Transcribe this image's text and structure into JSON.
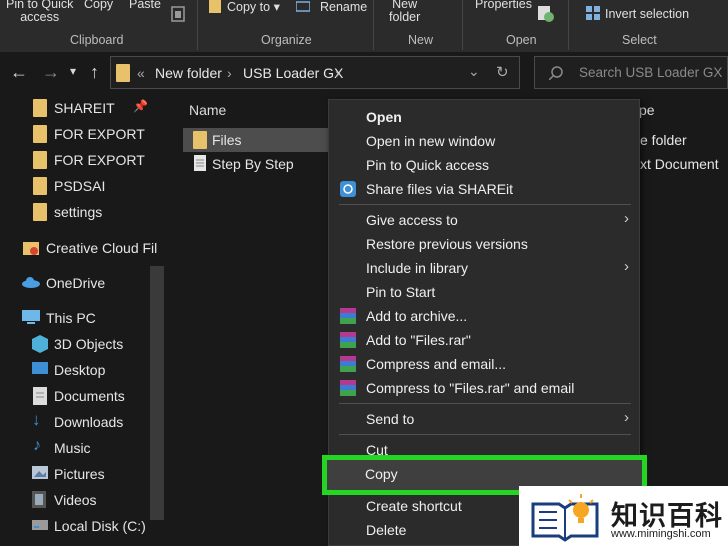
{
  "ribbon": {
    "pin_to_quick_access": "Pin to Quick\naccess",
    "copy": "Copy",
    "paste": "Paste",
    "copy_to": "Copy to",
    "rename": "Rename",
    "new_folder": "New\nfolder",
    "properties": "Properties",
    "invert_selection": "Invert selection",
    "groups": {
      "clipboard": "Clipboard",
      "organize": "Organize",
      "new": "New",
      "open": "Open",
      "select": "Select"
    }
  },
  "address": {
    "prefix": "«",
    "crumb1": "New folder",
    "sep": "›",
    "crumb2": "USB Loader GX",
    "search_placeholder": "Search USB Loader GX"
  },
  "navpane": {
    "items": [
      {
        "label": "SHAREIT",
        "icon": "folder-icon"
      },
      {
        "label": "FOR EXPORT",
        "icon": "folder-icon"
      },
      {
        "label": "FOR EXPORT",
        "icon": "folder-icon"
      },
      {
        "label": "PSDSAI",
        "icon": "folder-icon"
      },
      {
        "label": "settings",
        "icon": "folder-icon"
      },
      {
        "label": "Creative Cloud Fil",
        "icon": "creative-cloud-icon"
      },
      {
        "label": "OneDrive",
        "icon": "cloud-icon"
      },
      {
        "label": "This PC",
        "icon": "computer-icon"
      },
      {
        "label": "3D Objects",
        "icon": "cube-icon"
      },
      {
        "label": "Desktop",
        "icon": "desktop-icon"
      },
      {
        "label": "Documents",
        "icon": "documents-icon"
      },
      {
        "label": "Downloads",
        "icon": "download-icon"
      },
      {
        "label": "Music",
        "icon": "music-icon"
      },
      {
        "label": "Pictures",
        "icon": "pictures-icon"
      },
      {
        "label": "Videos",
        "icon": "video-icon"
      },
      {
        "label": "Local Disk (C:)",
        "icon": "disk-icon"
      }
    ]
  },
  "filepane": {
    "col_name": "Name",
    "col_type_partial": "pe",
    "files": [
      {
        "name": "Files",
        "type_partial": "e folder"
      },
      {
        "name": "Step By Step",
        "type_partial": "xt Document"
      }
    ]
  },
  "context_menu": {
    "items": {
      "open": "Open",
      "open_new_window": "Open in new window",
      "pin_quick": "Pin to Quick access",
      "share_shareit": "Share files via SHAREit",
      "give_access": "Give access to",
      "restore": "Restore previous versions",
      "include_library": "Include in library",
      "pin_start": "Pin to Start",
      "add_archive": "Add to archive...",
      "add_rar": "Add to \"Files.rar\"",
      "compress_email": "Compress and email...",
      "compress_rar_email": "Compress to \"Files.rar\" and email",
      "send_to": "Send to",
      "cut": "Cut",
      "copy": "Copy",
      "create_shortcut": "Create shortcut",
      "delete": "Delete"
    },
    "submenu_arrow": "›"
  },
  "watermark": {
    "title": "知识百科",
    "url": "www.mimingshi.com"
  },
  "colors": {
    "highlight": "#24d524",
    "folder": "#e8c26a"
  }
}
